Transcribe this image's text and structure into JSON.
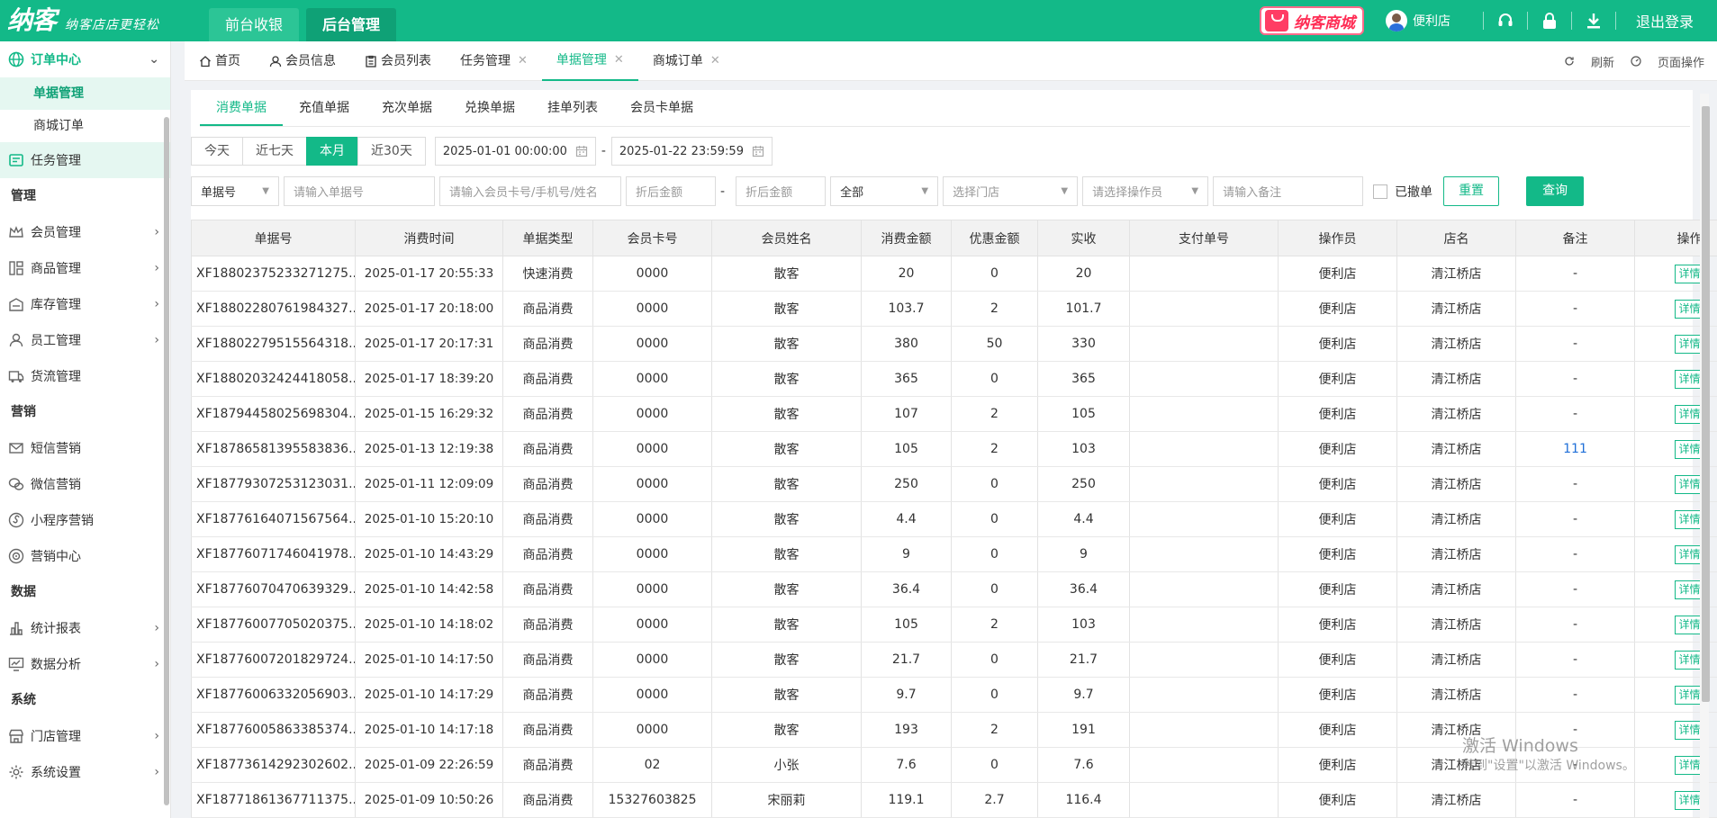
{
  "brand": {
    "logo": "纳客",
    "slogan": "纳客店店更轻松"
  },
  "top_nav": [
    {
      "label": "前台收银",
      "active": false
    },
    {
      "label": "后台管理",
      "active": true
    }
  ],
  "header": {
    "mall_label": "纳客商城",
    "user_name": "便利店",
    "logout_label": "退出登录"
  },
  "colors": {
    "brand": "#13b988",
    "mall": "#ff2d55"
  },
  "sidebar": {
    "order_center": {
      "label": "订单中心",
      "items": [
        "单据管理",
        "商城订单"
      ]
    },
    "task": "任务管理",
    "sections": [
      {
        "title": "管理",
        "items": [
          "会员管理",
          "商品管理",
          "库存管理",
          "员工管理",
          "货流管理"
        ]
      },
      {
        "title": "营销",
        "items": [
          "短信营销",
          "微信营销",
          "小程序营销",
          "营销中心"
        ]
      },
      {
        "title": "数据",
        "items": [
          "统计报表",
          "数据分析"
        ]
      },
      {
        "title": "系统",
        "items": [
          "门店管理",
          "系统设置"
        ]
      }
    ]
  },
  "tabs": [
    {
      "label": "首页",
      "closable": false,
      "active": false
    },
    {
      "label": "会员信息",
      "closable": false,
      "active": false
    },
    {
      "label": "会员列表",
      "closable": false,
      "active": false
    },
    {
      "label": "任务管理",
      "closable": true,
      "active": false
    },
    {
      "label": "单据管理",
      "closable": true,
      "active": true
    },
    {
      "label": "商城订单",
      "closable": true,
      "active": false
    }
  ],
  "tab_actions": {
    "refresh": "刷新",
    "page_ops": "页面操作"
  },
  "sub_tabs": [
    "消费单据",
    "充值单据",
    "充次单据",
    "兑换单据",
    "挂单列表",
    "会员卡单据"
  ],
  "quick_dates": [
    "今天",
    "近七天",
    "本月",
    "近30天"
  ],
  "date_range": {
    "start": "2025-01-01 00:00:00",
    "end": "2025-01-22 23:59:59",
    "sep": "-"
  },
  "filters": {
    "field_select": "单据号",
    "bill_no_ph": "请输入单据号",
    "member_ph": "请输入会员卡号/手机号/姓名",
    "amount_min_ph": "折后金额",
    "amount_sep": "-",
    "amount_max_ph": "折后金额",
    "type_select": "全部",
    "store_ph": "选择门店",
    "operator_ph": "请选择操作员",
    "note_ph": "请输入备注",
    "revoked_label": "已撤单",
    "reset": "重置",
    "query": "查询"
  },
  "table": {
    "columns": [
      "单据号",
      "消费时间",
      "单据类型",
      "会员卡号",
      "会员姓名",
      "消费金额",
      "优惠金额",
      "实收",
      "支付单号",
      "操作员",
      "店名",
      "备注",
      "操作"
    ],
    "detail_label": "详情",
    "rows": [
      [
        "XF18802375233271275...",
        "2025-01-17 20:55:33",
        "快速消费",
        "0000",
        "散客",
        "20",
        "0",
        "20",
        "",
        "便利店",
        "清江桥店",
        "-"
      ],
      [
        "XF18802280761984327...",
        "2025-01-17 20:18:00",
        "商品消费",
        "0000",
        "散客",
        "103.7",
        "2",
        "101.7",
        "",
        "便利店",
        "清江桥店",
        "-"
      ],
      [
        "XF18802279515564318...",
        "2025-01-17 20:17:31",
        "商品消费",
        "0000",
        "散客",
        "380",
        "50",
        "330",
        "",
        "便利店",
        "清江桥店",
        "-"
      ],
      [
        "XF18802032424418058...",
        "2025-01-17 18:39:20",
        "商品消费",
        "0000",
        "散客",
        "365",
        "0",
        "365",
        "",
        "便利店",
        "清江桥店",
        "-"
      ],
      [
        "XF18794458025698304...",
        "2025-01-15 16:29:32",
        "商品消费",
        "0000",
        "散客",
        "107",
        "2",
        "105",
        "",
        "便利店",
        "清江桥店",
        "-"
      ],
      [
        "XF18786581395583836...",
        "2025-01-13 12:19:38",
        "商品消费",
        "0000",
        "散客",
        "105",
        "2",
        "103",
        "",
        "便利店",
        "清江桥店",
        "111"
      ],
      [
        "XF18779307253123031...",
        "2025-01-11 12:09:09",
        "商品消费",
        "0000",
        "散客",
        "250",
        "0",
        "250",
        "",
        "便利店",
        "清江桥店",
        "-"
      ],
      [
        "XF18776164071567564...",
        "2025-01-10 15:20:10",
        "商品消费",
        "0000",
        "散客",
        "4.4",
        "0",
        "4.4",
        "",
        "便利店",
        "清江桥店",
        "-"
      ],
      [
        "XF18776071746041978...",
        "2025-01-10 14:43:29",
        "商品消费",
        "0000",
        "散客",
        "9",
        "0",
        "9",
        "",
        "便利店",
        "清江桥店",
        "-"
      ],
      [
        "XF18776070470639329...",
        "2025-01-10 14:42:58",
        "商品消费",
        "0000",
        "散客",
        "36.4",
        "0",
        "36.4",
        "",
        "便利店",
        "清江桥店",
        "-"
      ],
      [
        "XF18776007705020375...",
        "2025-01-10 14:18:02",
        "商品消费",
        "0000",
        "散客",
        "105",
        "2",
        "103",
        "",
        "便利店",
        "清江桥店",
        "-"
      ],
      [
        "XF18776007201829724...",
        "2025-01-10 14:17:50",
        "商品消费",
        "0000",
        "散客",
        "21.7",
        "0",
        "21.7",
        "",
        "便利店",
        "清江桥店",
        "-"
      ],
      [
        "XF18776006332056903...",
        "2025-01-10 14:17:29",
        "商品消费",
        "0000",
        "散客",
        "9.7",
        "0",
        "9.7",
        "",
        "便利店",
        "清江桥店",
        "-"
      ],
      [
        "XF18776005863385374...",
        "2025-01-10 14:17:18",
        "商品消费",
        "0000",
        "散客",
        "193",
        "2",
        "191",
        "",
        "便利店",
        "清江桥店",
        "-"
      ],
      [
        "XF18773614292302602...",
        "2025-01-09 22:26:59",
        "商品消费",
        "02",
        "小张",
        "7.6",
        "0",
        "7.6",
        "",
        "便利店",
        "清江桥店",
        "-"
      ],
      [
        "XF18771861367711375...",
        "2025-01-09 10:50:26",
        "商品消费",
        "15327603825",
        "宋丽莉",
        "119.1",
        "2.7",
        "116.4",
        "",
        "便利店",
        "清江桥店",
        "-"
      ]
    ]
  },
  "watermark": {
    "line1": "激活 Windows",
    "line2": "转到\"设置\"以激活 Windows。"
  }
}
